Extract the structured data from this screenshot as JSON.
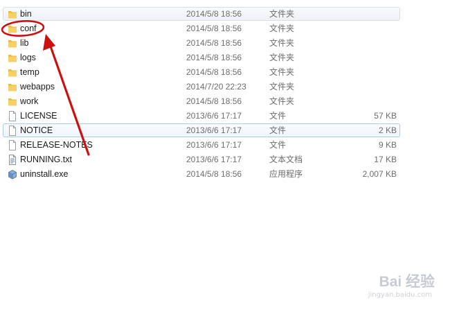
{
  "files": [
    {
      "name": "bin",
      "date": "2014/5/8 18:56",
      "type": "文件夹",
      "size": "",
      "icon": "folder-icon"
    },
    {
      "name": "conf",
      "date": "2014/5/8 18:56",
      "type": "文件夹",
      "size": "",
      "icon": "folder-icon"
    },
    {
      "name": "lib",
      "date": "2014/5/8 18:56",
      "type": "文件夹",
      "size": "",
      "icon": "folder-icon"
    },
    {
      "name": "logs",
      "date": "2014/5/8 18:56",
      "type": "文件夹",
      "size": "",
      "icon": "folder-icon"
    },
    {
      "name": "temp",
      "date": "2014/5/8 18:56",
      "type": "文件夹",
      "size": "",
      "icon": "folder-icon"
    },
    {
      "name": "webapps",
      "date": "2014/7/20 22:23",
      "type": "文件夹",
      "size": "",
      "icon": "folder-icon"
    },
    {
      "name": "work",
      "date": "2014/5/8 18:56",
      "type": "文件夹",
      "size": "",
      "icon": "folder-icon"
    },
    {
      "name": "LICENSE",
      "date": "2013/6/6 17:17",
      "type": "文件",
      "size": "57 KB",
      "icon": "file-icon"
    },
    {
      "name": "NOTICE",
      "date": "2013/6/6 17:17",
      "type": "文件",
      "size": "2 KB",
      "icon": "file-icon"
    },
    {
      "name": "RELEASE-NOTES",
      "date": "2013/6/6 17:17",
      "type": "文件",
      "size": "9 KB",
      "icon": "file-icon"
    },
    {
      "name": "RUNNING.txt",
      "date": "2013/6/6 17:17",
      "type": "文本文档",
      "size": "17 KB",
      "icon": "text-document-icon"
    },
    {
      "name": "uninstall.exe",
      "date": "2014/5/8 18:56",
      "type": "应用程序",
      "size": "2,007 KB",
      "icon": "exe-icon"
    }
  ],
  "hover_row": "bin",
  "selected_row": "NOTICE",
  "annotation": {
    "highlighted_item": "conf",
    "shapes": [
      "circle",
      "arrow"
    ],
    "color": "#cc1010"
  },
  "watermark": {
    "logo": "Bai 经验",
    "url": "jingyan.baidu.com"
  }
}
